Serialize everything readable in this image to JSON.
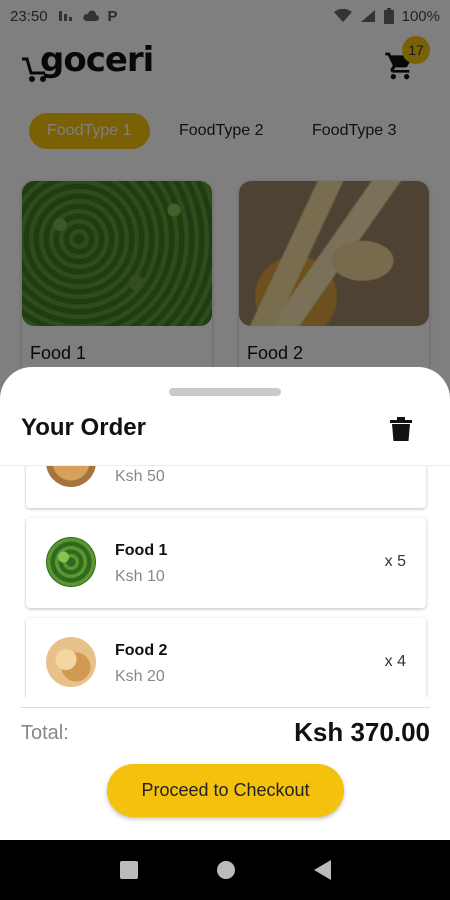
{
  "status": {
    "time": "23:50",
    "left_icons": [
      "sim-icon",
      "cloud-icon",
      "p-icon"
    ],
    "p_glyph": "P",
    "battery": "100%"
  },
  "header": {
    "logo": "goceri",
    "cart_count": "17"
  },
  "categories": [
    {
      "label": "FoodType 1",
      "active": true
    },
    {
      "label": "FoodType 2",
      "active": false
    },
    {
      "label": "FoodType 3",
      "active": false
    }
  ],
  "products": [
    {
      "name": "Food 1",
      "image": "peas"
    },
    {
      "name": "Food 2",
      "image": "corn"
    }
  ],
  "order": {
    "title": "Your Order",
    "items": [
      {
        "name": "",
        "price": "Ksh 50",
        "qty": ""
      },
      {
        "name": "Food 1",
        "price": "Ksh 10",
        "qty": "x 5"
      },
      {
        "name": "Food 2",
        "price": "Ksh 20",
        "qty": "x 4"
      }
    ],
    "total_label": "Total:",
    "total_value": "Ksh 370.00",
    "checkout_label": "Proceed to Checkout"
  },
  "colors": {
    "accent": "#f4c20d",
    "overlay": "rgba(0,0,0,0.5)"
  }
}
